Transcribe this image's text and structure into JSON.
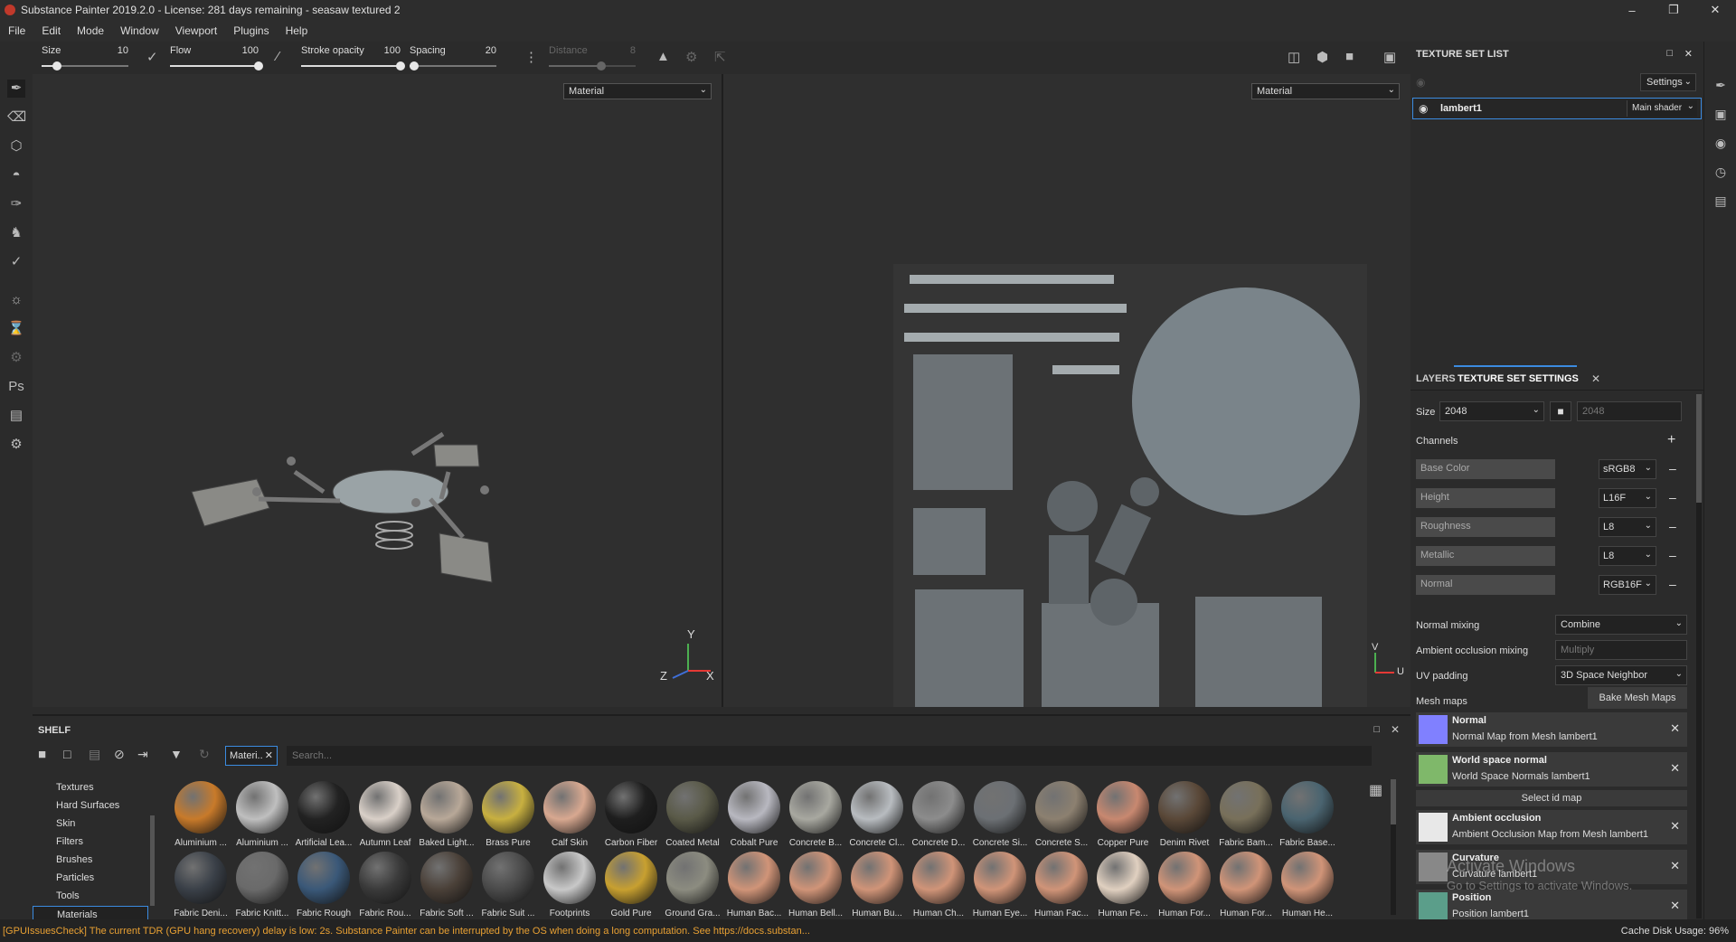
{
  "window": {
    "title": "Substance Painter 2019.2.0 - License: 281 days remaining - seasaw textured 2"
  },
  "menu": [
    "File",
    "Edit",
    "Mode",
    "Window",
    "Viewport",
    "Plugins",
    "Help"
  ],
  "toolbar": {
    "size": {
      "label": "Size",
      "value": "10",
      "level": 0.18
    },
    "flow": {
      "label": "Flow",
      "value": "100",
      "level": 1.0
    },
    "stroke_opacity": {
      "label": "Stroke opacity",
      "value": "100",
      "level": 1.0
    },
    "spacing": {
      "label": "Spacing",
      "value": "20",
      "level": 0.05
    },
    "distance": {
      "label": "Distance",
      "value": "8",
      "level": 0.6
    }
  },
  "viewport_left": {
    "mode": "Material"
  },
  "viewport_right": {
    "mode": "Material"
  },
  "axes_3d": {
    "y": "Y",
    "z": "Z",
    "x": "X"
  },
  "axes_2d": {
    "v": "V",
    "u": "U"
  },
  "texture_set_list": {
    "title": "TEXTURE SET LIST",
    "settings_label": "Settings",
    "item": "lambert1",
    "shader": "Main shader"
  },
  "tabs": {
    "layers": "LAYERS",
    "settings": "TEXTURE SET SETTINGS"
  },
  "texture_settings": {
    "size_label": "Size",
    "size_value": "2048",
    "size_locked_value": "2048",
    "channels_label": "Channels",
    "channels": [
      {
        "name": "Base Color",
        "format": "sRGB8"
      },
      {
        "name": "Height",
        "format": "L16F"
      },
      {
        "name": "Roughness",
        "format": "L8"
      },
      {
        "name": "Metallic",
        "format": "L8"
      },
      {
        "name": "Normal",
        "format": "RGB16F"
      }
    ],
    "normal_mixing_label": "Normal mixing",
    "normal_mixing": "Combine",
    "ao_mixing_label": "Ambient occlusion mixing",
    "ao_mixing": "Multiply",
    "uv_padding_label": "UV padding",
    "uv_padding": "3D Space Neighbor",
    "mesh_maps_label": "Mesh maps",
    "bake_label": "Bake Mesh Maps",
    "select_id_map": "Select id map",
    "mesh_maps": [
      {
        "title": "Normal",
        "sub": "Normal Map from Mesh lambert1",
        "color": "#8080ff"
      },
      {
        "title": "World space normal",
        "sub": "World Space Normals lambert1",
        "color": "#7fb86a"
      },
      {
        "title": "Ambient occlusion",
        "sub": "Ambient Occlusion Map from Mesh lambert1",
        "color": "#e8e8e8"
      },
      {
        "title": "Curvature",
        "sub": "Curvature lambert1",
        "color": "#888888"
      },
      {
        "title": "Position",
        "sub": "Position lambert1",
        "color": "#5b9e8a"
      }
    ]
  },
  "shelf": {
    "title": "SHELF",
    "filter_tag": "Materi..",
    "search_placeholder": "Search...",
    "categories": [
      "Textures",
      "Hard Surfaces",
      "Skin",
      "Filters",
      "Brushes",
      "Particles",
      "Tools",
      "Materials"
    ],
    "selected_category": "Materials",
    "materials_row1": [
      {
        "name": "Aluminium ...",
        "color": "#c87a2a"
      },
      {
        "name": "Aluminium ...",
        "color": "#bfbfbf"
      },
      {
        "name": "Artificial Lea...",
        "color": "#222222"
      },
      {
        "name": "Autumn Leaf",
        "color": "#d9d0c8"
      },
      {
        "name": "Baked Light...",
        "color": "#b8a898"
      },
      {
        "name": "Brass Pure",
        "color": "#c8b040"
      },
      {
        "name": "Calf Skin",
        "color": "#d8a890"
      },
      {
        "name": "Carbon Fiber",
        "color": "#1e1e1e"
      },
      {
        "name": "Coated Metal",
        "color": "#5a5a48"
      },
      {
        "name": "Cobalt Pure",
        "color": "#b8b8c0"
      },
      {
        "name": "Concrete B...",
        "color": "#a8a8a0"
      },
      {
        "name": "Concrete Cl...",
        "color": "#b8bcc0"
      },
      {
        "name": "Concrete D...",
        "color": "#8c8c8c"
      },
      {
        "name": "Concrete Si...",
        "color": "#6c7074"
      },
      {
        "name": "Concrete S...",
        "color": "#8c8070"
      },
      {
        "name": "Copper Pure",
        "color": "#c88870"
      },
      {
        "name": "Denim Rivet",
        "color": "#5a4838"
      },
      {
        "name": "Fabric Bam...",
        "color": "#78705a"
      },
      {
        "name": "Fabric Base...",
        "color": "#4a6470"
      }
    ],
    "materials_row2": [
      {
        "name": "Fabric Deni...",
        "color": "#3a4048"
      },
      {
        "name": "Fabric Knitt...",
        "color": "#6a6a6a"
      },
      {
        "name": "Fabric Rough",
        "color": "#3a5878"
      },
      {
        "name": "Fabric Rou...",
        "color": "#3a3a3a"
      },
      {
        "name": "Fabric Soft ...",
        "color": "#4a4038"
      },
      {
        "name": "Fabric Suit ...",
        "color": "#4a4a4a"
      },
      {
        "name": "Footprints",
        "color": "#c8c8c8"
      },
      {
        "name": "Gold Pure",
        "color": "#c8a030"
      },
      {
        "name": "Ground Gra...",
        "color": "#8c8c80"
      },
      {
        "name": "Human Bac...",
        "color": "#d09478"
      },
      {
        "name": "Human Bell...",
        "color": "#d09478"
      },
      {
        "name": "Human Bu...",
        "color": "#d09478"
      },
      {
        "name": "Human Ch...",
        "color": "#d09478"
      },
      {
        "name": "Human Eye...",
        "color": "#d09478"
      },
      {
        "name": "Human Fac...",
        "color": "#d09478"
      },
      {
        "name": "Human Fe...",
        "color": "#e0d0c0"
      },
      {
        "name": "Human For...",
        "color": "#d09478"
      },
      {
        "name": "Human For...",
        "color": "#d09478"
      },
      {
        "name": "Human He...",
        "color": "#d09478"
      }
    ]
  },
  "status": {
    "message": "[GPUIssuesCheck] The current TDR (GPU hang recovery) delay is low: 2s. Substance Painter can be interrupted by the OS when doing a long computation. See https://docs.substan...",
    "cache": "Cache Disk Usage:    96%"
  },
  "watermark": {
    "title": "Activate Windows",
    "sub": "Go to Settings to activate Windows."
  }
}
